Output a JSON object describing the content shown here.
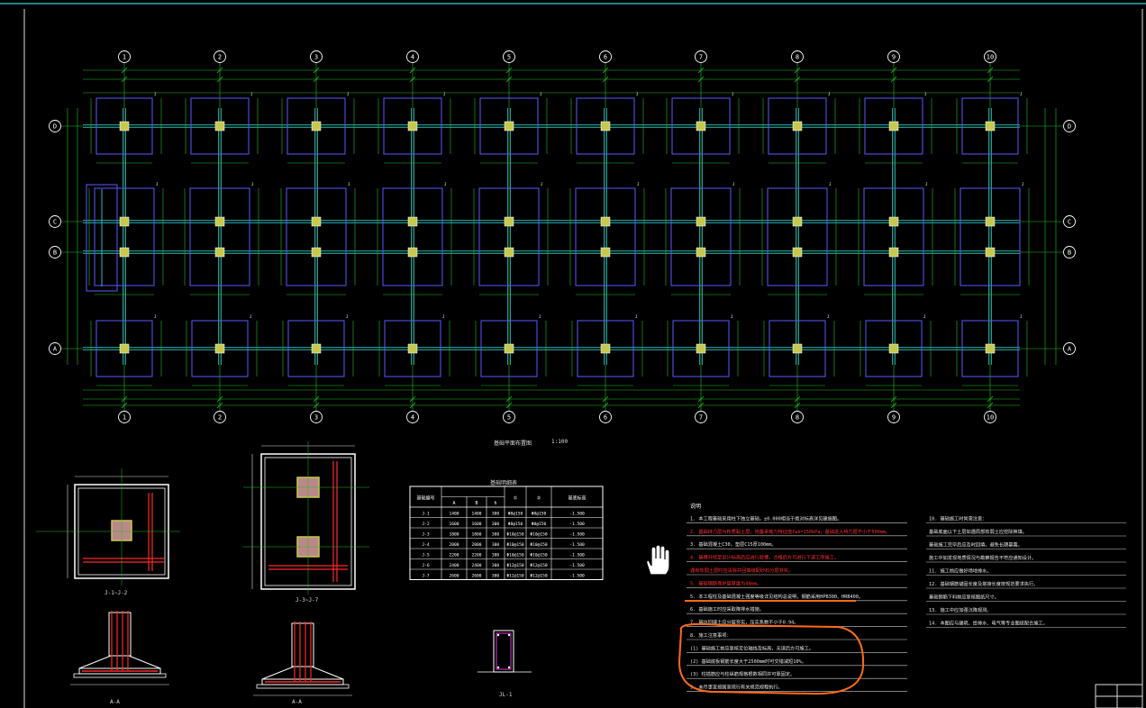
{
  "axes_top": [
    "1",
    "2",
    "3",
    "4",
    "5",
    "6",
    "7",
    "8",
    "9",
    "10"
  ],
  "axes_side": [
    "D",
    "C",
    "B",
    "A"
  ],
  "table": {
    "title": "基础明细表",
    "headers": [
      "基础编号",
      "A",
      "B",
      "h",
      "①",
      "②",
      "基底标高"
    ],
    "rows": [
      [
        "J-1",
        "1400",
        "1400",
        "300",
        "Φ8@150",
        "Φ8@150",
        "-1.500"
      ],
      [
        "J-2",
        "1600",
        "1600",
        "300",
        "Φ8@150",
        "Φ8@150",
        "-1.500"
      ],
      [
        "J-3",
        "1800",
        "1800",
        "300",
        "Φ10@150",
        "Φ10@150",
        "-1.500"
      ],
      [
        "J-4",
        "2000",
        "2000",
        "300",
        "Φ10@150",
        "Φ10@150",
        "-1.500"
      ],
      [
        "J-5",
        "2200",
        "2200",
        "300",
        "Φ10@150",
        "Φ10@150",
        "-1.500"
      ],
      [
        "J-6",
        "2400",
        "2400",
        "300",
        "Φ12@150",
        "Φ12@150",
        "-1.500"
      ],
      [
        "J-7",
        "2600",
        "2600",
        "300",
        "Φ12@150",
        "Φ12@150",
        "-1.500"
      ]
    ]
  },
  "plan_title": "基础平面布置图",
  "plan_scale": "1:100",
  "detail_labels": {
    "k12": "J-1~J-2",
    "k37": "J-3~J-7",
    "aa1": "A-A",
    "aa2": "A-A",
    "jl": "JL-1"
  },
  "notes_left": {
    "title": "说明",
    "lines": [
      {
        "t": "1. 本工程基础采用柱下独立基础，±0.000相当于绝对标高详见建施图。",
        "c": "white"
      },
      {
        "t": "2. 基础持力层为粉质黏土层，地基承载力特征值fak=150kPa，基础进入持力层不小于500mm。",
        "c": "red"
      },
      {
        "t": "3. 基础混凝土C30，垫层C15厚100mm。",
        "c": "white"
      },
      {
        "t": "4. 基槽开挖至设计标高后应进行验槽，合格后方可进行下道工序施工。",
        "c": "red"
      },
      {
        "t": "   遇有软弱土层时应清除并回填级配砂石分层夯实。",
        "c": "red"
      },
      {
        "t": "5. 基础钢筋保护层厚度为40mm。",
        "c": "red"
      },
      {
        "t": "5. 本工程柱及基础混凝土强度等级详见结构总说明，钢筋采用HPB300、HRB400。",
        "c": "white"
      },
      {
        "t": "6. 基础施工时应采取降排水措施。",
        "c": "white"
      },
      {
        "t": "7. 基坑回填土应分层夯实，压实系数不小于0.94。",
        "c": "white"
      },
      {
        "t": "8. 施工注意事项：",
        "c": "white"
      },
      {
        "t": "(1) 基础施工前应复核定位轴线及标高，无误后方可施工。",
        "c": "white"
      },
      {
        "t": "(2) 基础底板钢筋长度大于2500mm时可交错减短10%。",
        "c": "white"
      },
      {
        "t": "(3) 柱插筋应与柱纵筋规格根数相同并可靠固定。",
        "c": "white"
      },
      {
        "t": "9. 未尽事宜按国家现行有关规范规程执行。",
        "c": "white"
      }
    ]
  },
  "notes_right": {
    "lines": [
      "10. 基础施工时尚需注意：",
      "基础底面以下土层如遇局部软弱土应挖除换填。",
      "基础施工完毕后应及时回填，避免长期暴露。",
      "施工中如发现地质情况与勘察报告不符应通知设计。",
      "11. 施工前应做好场地排水。",
      "12. 基础钢筋锚固长度及搭接长度按规范要求执行。",
      "基础钢筋下料前应复核图纸尺寸。",
      "13. 施工中应加强沉降观测。",
      "14. 本图应与建筑、给排水、电气等专业图纸配合施工。"
    ]
  }
}
